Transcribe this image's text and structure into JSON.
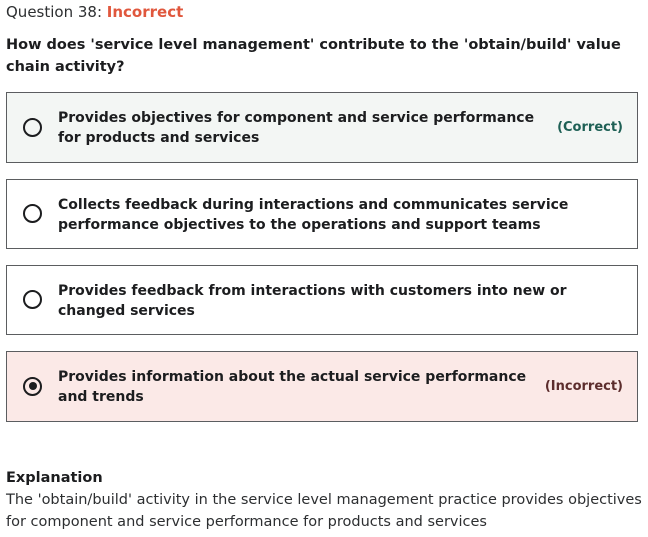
{
  "question": {
    "label": "Question 38:",
    "status": "Incorrect",
    "text": "How does 'service level management' contribute to the 'obtain/build' value chain activity?"
  },
  "options": [
    {
      "text": "Provides objectives for component and service performance for products and services",
      "tag": "(Correct)",
      "selected": false
    },
    {
      "text": "Collects feedback during interactions and communicates service performance objectives to the operations and support teams",
      "tag": "",
      "selected": false
    },
    {
      "text": "Provides feedback from interactions with customers into new or changed services",
      "tag": "",
      "selected": false
    },
    {
      "text": "Provides information about the actual service performance and trends",
      "tag": "(Incorrect)",
      "selected": true
    }
  ],
  "explanation": {
    "title": "Explanation",
    "body": "The 'obtain/build' activity in the service level management practice provides objectives for component and service performance for products and services"
  },
  "colors": {
    "incorrect_status": "#e0573d",
    "correct_bg": "#f3f6f4",
    "incorrect_bg": "#fbe9e7",
    "correct_tag": "#1e6055",
    "incorrect_tag": "#5c2d2d"
  }
}
